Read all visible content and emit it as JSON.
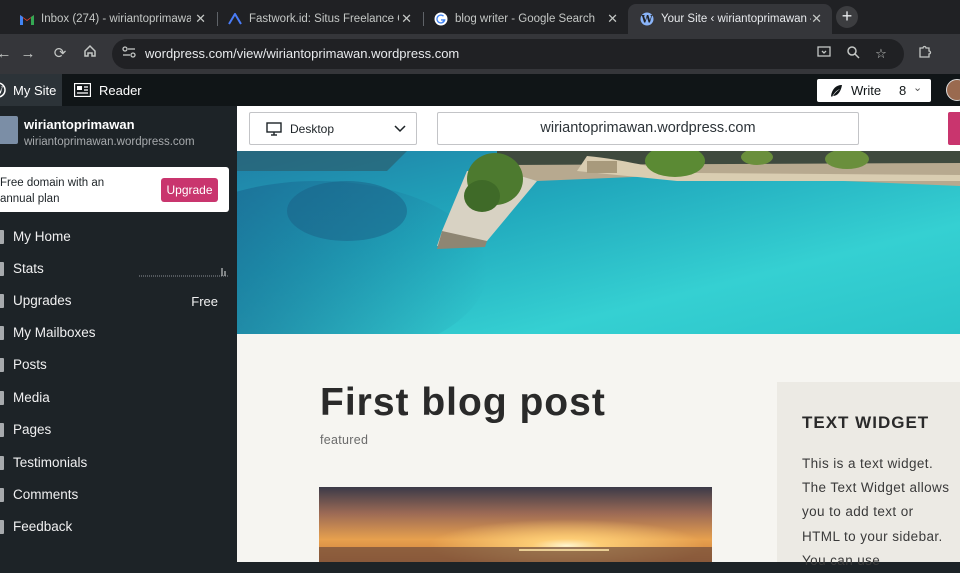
{
  "browser": {
    "tabs": [
      {
        "title": "Inbox (274) - wiriantoprimawan",
        "icon": "gmail-icon"
      },
      {
        "title": "Fastwork.id: Situs Freelance Onl",
        "icon": "fastwork-icon"
      },
      {
        "title": "blog writer - Google Search",
        "icon": "google-icon"
      },
      {
        "title": "Your Site ‹ wiriantoprimawan —",
        "icon": "wordpress-icon",
        "active": true
      }
    ],
    "url": "wordpress.com/view/wiriantoprimawan.wordpress.com"
  },
  "wp_admin_bar": {
    "my_site": "My Site",
    "reader": "Reader",
    "write": "Write",
    "notif_count": "8"
  },
  "sidebar": {
    "site_name": "wiriantoprimawan",
    "site_url": "wiriantoprimawan.wordpress.com",
    "upsell_text": "Free domain with an annual plan",
    "upgrade_label": "Upgrade",
    "items": [
      {
        "label": "My Home"
      },
      {
        "label": "Stats"
      },
      {
        "label": "Upgrades",
        "extra": "Free"
      },
      {
        "label": "My Mailboxes"
      },
      {
        "label": "Posts"
      },
      {
        "label": "Media"
      },
      {
        "label": "Pages"
      },
      {
        "label": "Testimonials"
      },
      {
        "label": "Comments"
      },
      {
        "label": "Feedback"
      }
    ]
  },
  "preview": {
    "device": "Desktop",
    "site_url": "wiriantoprimawan.wordpress.com"
  },
  "post": {
    "title": "First blog post",
    "category": "featured"
  },
  "widget": {
    "title": "TEXT WIDGET",
    "text": "This is a text widget. The Text Widget allows you to add text or HTML to your sidebar. You can use"
  },
  "colors": {
    "accent": "#c9356e",
    "sidebar_bg": "#1d2327",
    "content_bg": "#f6f5f1"
  }
}
